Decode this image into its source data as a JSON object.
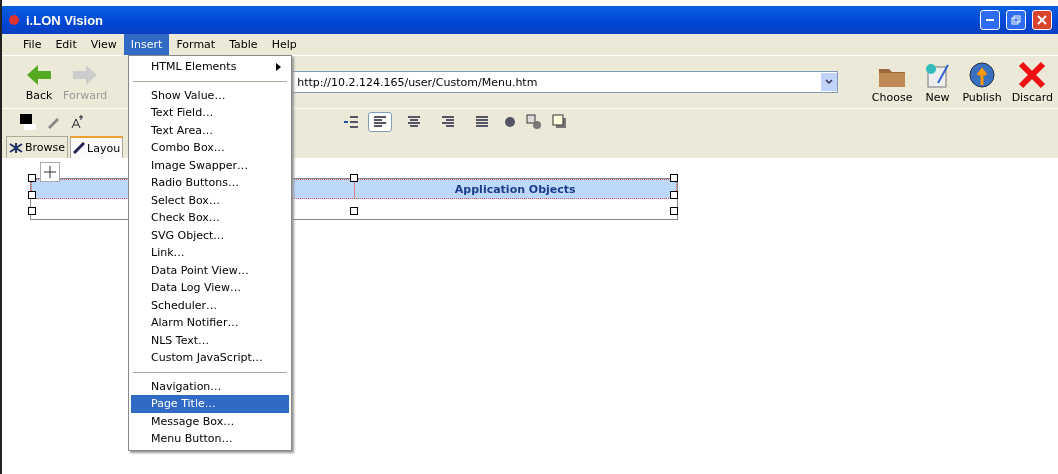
{
  "window": {
    "title": "i.LON Vision"
  },
  "menubar": [
    {
      "label": "File",
      "selected": false
    },
    {
      "label": "Edit",
      "selected": false
    },
    {
      "label": "View",
      "selected": false
    },
    {
      "label": "Insert",
      "selected": true
    },
    {
      "label": "Format",
      "selected": false
    },
    {
      "label": "Table",
      "selected": false
    },
    {
      "label": "Help",
      "selected": false
    }
  ],
  "toolbar": {
    "back": "Back",
    "forward": {
      "label": "Forward",
      "disabled": true
    },
    "url": "http://10.2.124.165/user/Custom/Menu.htm",
    "actions": [
      {
        "kind": "folder",
        "label": "Choose"
      },
      {
        "kind": "new",
        "label": "New"
      },
      {
        "kind": "publish",
        "label": "Publish"
      },
      {
        "kind": "discard",
        "label": "Discard"
      }
    ]
  },
  "format_toolbar": {
    "align": [
      {
        "kind": "left",
        "selected": true
      },
      {
        "kind": "center",
        "selected": false
      },
      {
        "kind": "right",
        "selected": false
      },
      {
        "kind": "justify",
        "selected": false
      }
    ]
  },
  "tabs": [
    {
      "label": "Browse",
      "selected": false
    },
    {
      "label": "Layou",
      "selected": true
    }
  ],
  "table": {
    "header": "Application Objects"
  },
  "insert_menu": [
    {
      "kind": "submenu",
      "label": "HTML Elements",
      "selected": false
    },
    {
      "kind": "separator"
    },
    {
      "kind": "item",
      "label": "Show Value…",
      "selected": false
    },
    {
      "kind": "item",
      "label": "Text Field…",
      "selected": false
    },
    {
      "kind": "item",
      "label": "Text Area…",
      "selected": false
    },
    {
      "kind": "item",
      "label": "Combo Box…",
      "selected": false
    },
    {
      "kind": "item",
      "label": "Image Swapper…",
      "selected": false
    },
    {
      "kind": "item",
      "label": "Radio Buttons…",
      "selected": false
    },
    {
      "kind": "item",
      "label": "Select Box…",
      "selected": false
    },
    {
      "kind": "item",
      "label": "Check Box…",
      "selected": false
    },
    {
      "kind": "item",
      "label": "SVG Object…",
      "selected": false
    },
    {
      "kind": "item",
      "label": "Link…",
      "selected": false
    },
    {
      "kind": "item",
      "label": "Data Point View…",
      "selected": false
    },
    {
      "kind": "item",
      "label": "Data Log View…",
      "selected": false
    },
    {
      "kind": "item",
      "label": "Scheduler…",
      "selected": false
    },
    {
      "kind": "item",
      "label": "Alarm Notifier…",
      "selected": false
    },
    {
      "kind": "item",
      "label": "NLS Text…",
      "selected": false
    },
    {
      "kind": "item",
      "label": "Custom JavaScript…",
      "selected": false
    },
    {
      "kind": "separator"
    },
    {
      "kind": "item",
      "label": "Navigation…",
      "selected": false
    },
    {
      "kind": "item",
      "label": "Page Title…",
      "selected": true
    },
    {
      "kind": "item",
      "label": "Message Box…",
      "selected": false
    },
    {
      "kind": "item",
      "label": "Menu Button…",
      "selected": false
    }
  ]
}
